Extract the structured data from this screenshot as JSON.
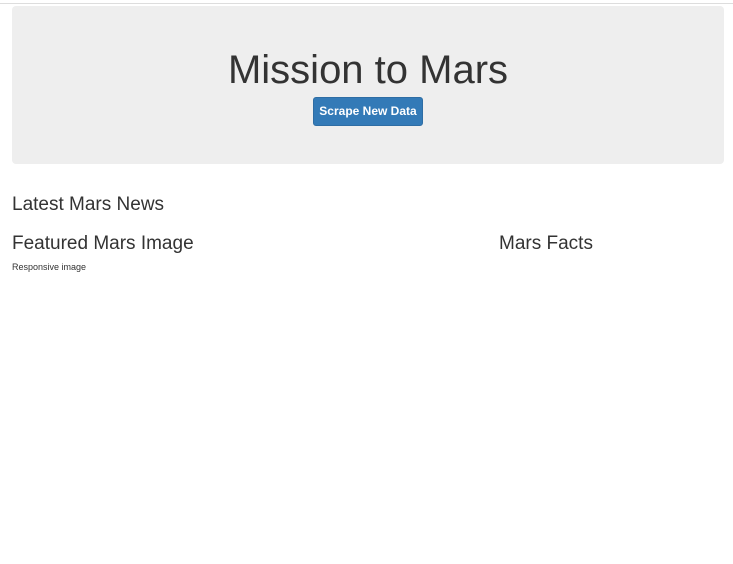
{
  "jumbotron": {
    "title": "Mission to Mars",
    "button_label": "Scrape New Data",
    "background_color": "#eeeeee",
    "button_color": "#337ab7"
  },
  "news": {
    "heading": "Latest Mars News"
  },
  "featured_image": {
    "heading": "Featured Mars Image",
    "alt_text": "Responsive image",
    "icon": "broken-image-icon"
  },
  "facts": {
    "heading": "Mars Facts"
  }
}
